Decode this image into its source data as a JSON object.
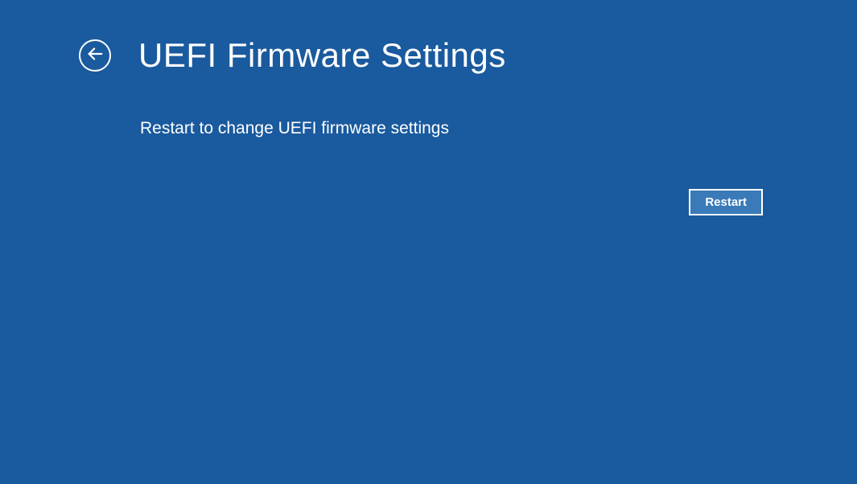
{
  "header": {
    "title": "UEFI Firmware Settings"
  },
  "main": {
    "description": "Restart to change UEFI firmware settings"
  },
  "actions": {
    "restart_label": "Restart"
  }
}
